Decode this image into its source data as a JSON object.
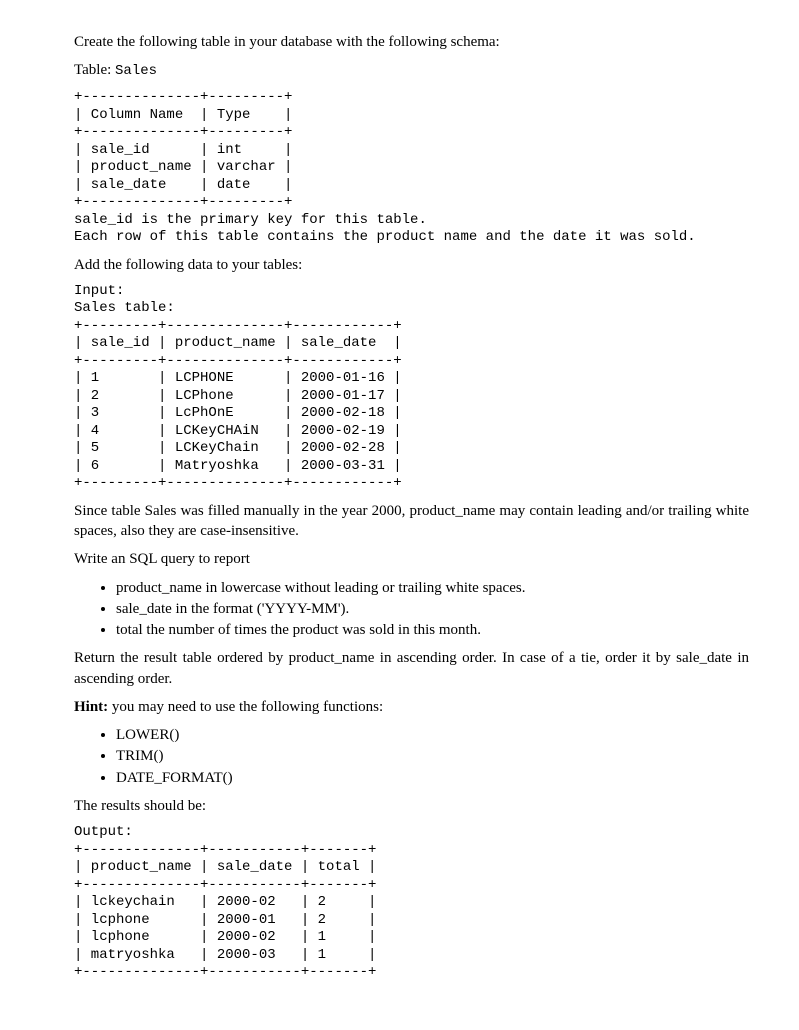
{
  "intro1": "Create the following table in your database with the following schema:",
  "table_label_prefix": "Table: ",
  "table_name": "Sales",
  "schema_block": "+--------------+---------+\n| Column Name  | Type    |\n+--------------+---------+\n| sale_id      | int     |\n| product_name | varchar |\n| sale_date    | date    |\n+--------------+---------+\nsale_id is the primary key for this table.\nEach row of this table contains the product name and the date it was sold.",
  "add_data": "Add the following data to your tables:",
  "input_block": "Input:\nSales table:\n+---------+--------------+------------+\n| sale_id | product_name | sale_date  |\n+---------+--------------+------------+\n| 1       | LCPHONE      | 2000-01-16 |\n| 2       | LCPhone      | 2000-01-17 |\n| 3       | LcPhOnE      | 2000-02-18 |\n| 4       | LCKeyCHAiN   | 2000-02-19 |\n| 5       | LCKeyChain   | 2000-02-28 |\n| 6       | Matryoshka   | 2000-03-31 |\n+---------+--------------+------------+",
  "since_para": "Since table Sales was filled manually in the year 2000, product_name may contain leading and/or trailing white spaces, also they are case-insensitive.",
  "write_query": "Write an SQL query to report",
  "req1": "product_name in lowercase without leading or trailing white spaces.",
  "req2": "sale_date in the format ('YYYY-MM').",
  "req3": "total the number of times the product was sold in this month.",
  "return_para": "Return the result table ordered by product_name in ascending order. In case of a tie, order it by sale_date in ascending order.",
  "hint_label": "Hint:",
  "hint_rest": " you may need to use the following functions:",
  "fn1": "LOWER()",
  "fn2": "TRIM()",
  "fn3": "DATE_FORMAT()",
  "results_label": "The results should be:",
  "output_block": "Output:\n+--------------+-----------+-------+\n| product_name | sale_date | total |\n+--------------+-----------+-------+\n| lckeychain   | 2000-02   | 2     |\n| lcphone      | 2000-01   | 2     |\n| lcphone      | 2000-02   | 1     |\n| matryoshka   | 2000-03   | 1     |\n+--------------+-----------+-------+",
  "chart_data": {
    "type": "table",
    "schema": {
      "columns": [
        "Column Name",
        "Type"
      ],
      "rows": [
        [
          "sale_id",
          "int"
        ],
        [
          "product_name",
          "varchar"
        ],
        [
          "sale_date",
          "date"
        ]
      ],
      "notes": [
        "sale_id is the primary key for this table.",
        "Each row of this table contains the product name and the date it was sold."
      ]
    },
    "input_table": {
      "name": "Sales",
      "columns": [
        "sale_id",
        "product_name",
        "sale_date"
      ],
      "rows": [
        [
          1,
          "LCPHONE",
          "2000-01-16"
        ],
        [
          2,
          "LCPhone",
          "2000-01-17"
        ],
        [
          3,
          "LcPhOnE",
          "2000-02-18"
        ],
        [
          4,
          "LCKeyCHAiN",
          "2000-02-19"
        ],
        [
          5,
          "LCKeyChain",
          "2000-02-28"
        ],
        [
          6,
          "Matryoshka",
          "2000-03-31"
        ]
      ]
    },
    "output_table": {
      "columns": [
        "product_name",
        "sale_date",
        "total"
      ],
      "rows": [
        [
          "lckeychain",
          "2000-02",
          2
        ],
        [
          "lcphone",
          "2000-01",
          2
        ],
        [
          "lcphone",
          "2000-02",
          1
        ],
        [
          "matryoshka",
          "2000-03",
          1
        ]
      ]
    }
  }
}
